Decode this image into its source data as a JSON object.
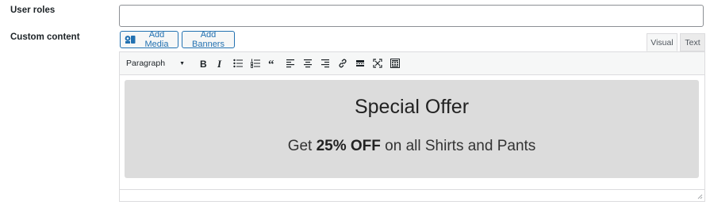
{
  "fields": {
    "user_roles_label": "User roles",
    "custom_content_label": "Custom content",
    "user_roles_value": ""
  },
  "editor": {
    "buttons": {
      "add_media": "Add Media",
      "add_banners": "Add Banners"
    },
    "tabs": {
      "visual": "Visual",
      "text": "Text",
      "active": "Visual"
    },
    "format_select": "Paragraph",
    "toolbar_icons": [
      "bold-icon",
      "italic-icon",
      "bulleted-list-icon",
      "numbered-list-icon",
      "blockquote-icon",
      "align-left-icon",
      "align-center-icon",
      "align-right-icon",
      "insert-link-icon",
      "read-more-icon",
      "fullscreen-icon",
      "toolbar-toggle-icon"
    ],
    "content": {
      "heading": "Special Offer",
      "line_prefix": "Get ",
      "line_bold": "25% OFF",
      "line_suffix": " on all Shirts and Pants"
    }
  },
  "colors": {
    "accent": "#2271b1",
    "content_bg": "#dcdcdc",
    "border": "#dcdcde"
  }
}
